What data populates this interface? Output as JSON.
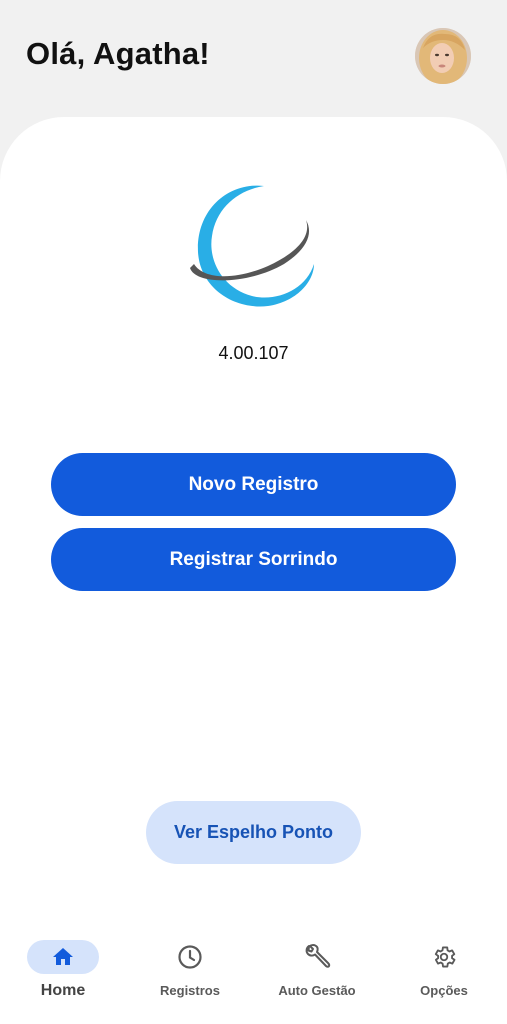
{
  "header": {
    "greeting": "Olá, Agatha!"
  },
  "app": {
    "version": "4.00.107"
  },
  "actions": {
    "novo_registro": "Novo Registro",
    "registrar_sorrindo": "Registrar Sorrindo",
    "ver_espelho_ponto": "Ver Espelho Ponto"
  },
  "nav": {
    "items": [
      {
        "label": "Home",
        "icon": "home-icon",
        "active": true
      },
      {
        "label": "Registros",
        "icon": "clock-icon",
        "active": false
      },
      {
        "label": "Auto Gestão",
        "icon": "wrench-icon",
        "active": false
      },
      {
        "label": "Opções",
        "icon": "gear-icon",
        "active": false
      }
    ]
  },
  "colors": {
    "primary": "#125bdc",
    "primary_light": "#d5e3fb",
    "logo_blue": "#29aee6",
    "logo_gray": "#555555",
    "background": "#f1f1f1"
  }
}
